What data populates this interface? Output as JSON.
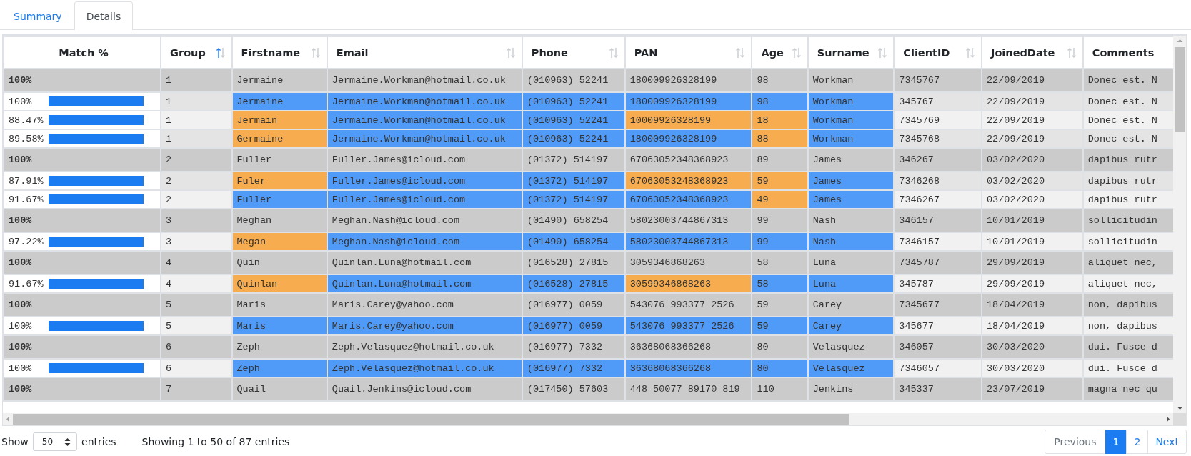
{
  "tabs": [
    {
      "label": "Summary",
      "selected": false
    },
    {
      "label": "Details",
      "selected": true
    }
  ],
  "table": {
    "columns": [
      {
        "label": "Match %"
      },
      {
        "label": "Group",
        "sorted_ascending": true
      },
      {
        "label": "Firstname",
        "sorted_ascending": false
      },
      {
        "label": "Email",
        "sorted_ascending": false
      },
      {
        "label": "Phone",
        "sorted_ascending": false
      },
      {
        "label": "PAN",
        "sorted_ascending": false
      },
      {
        "label": "Age",
        "sorted_ascending": false
      },
      {
        "label": "Surname",
        "sorted_ascending": false
      },
      {
        "label": "ClientID",
        "sorted_ascending": false
      },
      {
        "label": "JoinedDate",
        "sorted_ascending": false
      },
      {
        "label": "Comments"
      }
    ],
    "rows": [
      {
        "kind": "master",
        "cells": [
          {
            "text": "100%"
          },
          {
            "text": "1"
          },
          {
            "text": "Jermaine"
          },
          {
            "text": "Jermaine.Workman@hotmail.co.uk"
          },
          {
            "text": "(010963) 52241"
          },
          {
            "text": "180009926328199"
          },
          {
            "text": "98"
          },
          {
            "text": "Workman"
          },
          {
            "text": "7345767"
          },
          {
            "text": "22/09/2019"
          },
          {
            "text": "Donec est. N"
          }
        ]
      },
      {
        "kind": "match",
        "cells": [
          {
            "text": "100%"
          },
          {
            "text": "1"
          },
          {
            "text": "Jermaine",
            "matches": true
          },
          {
            "text": "Jermaine.Workman@hotmail.co.uk",
            "matches": true
          },
          {
            "text": "(010963) 52241",
            "matches": true
          },
          {
            "text": "180009926328199",
            "matches": true
          },
          {
            "text": "98",
            "matches": true
          },
          {
            "text": "Workman",
            "matches": true
          },
          {
            "text": "345767"
          },
          {
            "text": "22/09/2019"
          },
          {
            "text": "Donec est. N"
          }
        ]
      },
      {
        "kind": "match",
        "cells": [
          {
            "text": "88.47%"
          },
          {
            "text": "1"
          },
          {
            "text": "Jermain",
            "matches": false
          },
          {
            "text": "Jermaine.Workman@hotmail.co.uk",
            "matches": true
          },
          {
            "text": "(010963) 52241",
            "matches": true
          },
          {
            "text": "10009926328199",
            "matches": false
          },
          {
            "text": "18",
            "matches": false
          },
          {
            "text": "Workman",
            "matches": true
          },
          {
            "text": "7345769"
          },
          {
            "text": "22/09/2019"
          },
          {
            "text": "Donec est. N"
          }
        ]
      },
      {
        "kind": "match",
        "cells": [
          {
            "text": "89.58%"
          },
          {
            "text": "1"
          },
          {
            "text": "Germaine",
            "matches": false
          },
          {
            "text": "Jermaine.Workman@hotmail.co.uk",
            "matches": true
          },
          {
            "text": "(010963) 52241",
            "matches": true
          },
          {
            "text": "180009926328199",
            "matches": true
          },
          {
            "text": "88",
            "matches": false
          },
          {
            "text": "Workman",
            "matches": true
          },
          {
            "text": "7345768"
          },
          {
            "text": "22/09/2019"
          },
          {
            "text": "Donec est. N"
          }
        ]
      },
      {
        "kind": "master",
        "cells": [
          {
            "text": "100%"
          },
          {
            "text": "2"
          },
          {
            "text": "Fuller"
          },
          {
            "text": "Fuller.James@icloud.com"
          },
          {
            "text": "(01372) 514197"
          },
          {
            "text": "67063052348368923"
          },
          {
            "text": "89"
          },
          {
            "text": "James"
          },
          {
            "text": "346267"
          },
          {
            "text": "03/02/2020"
          },
          {
            "text": "dapibus rutr"
          }
        ]
      },
      {
        "kind": "match",
        "cells": [
          {
            "text": "87.91%"
          },
          {
            "text": "2"
          },
          {
            "text": "Fuler",
            "matches": false
          },
          {
            "text": "Fuller.James@icloud.com",
            "matches": true
          },
          {
            "text": "(01372) 514197",
            "matches": true
          },
          {
            "text": "67063053248368923",
            "matches": false
          },
          {
            "text": "59",
            "matches": false
          },
          {
            "text": "James",
            "matches": true
          },
          {
            "text": "7346268"
          },
          {
            "text": "03/02/2020"
          },
          {
            "text": "dapibus rutr"
          }
        ]
      },
      {
        "kind": "match",
        "cells": [
          {
            "text": "91.67%"
          },
          {
            "text": "2"
          },
          {
            "text": "Fuller",
            "matches": true
          },
          {
            "text": "Fuller.James@icloud.com",
            "matches": true
          },
          {
            "text": "(01372) 514197",
            "matches": true
          },
          {
            "text": "67063052348368923",
            "matches": true
          },
          {
            "text": "49",
            "matches": false
          },
          {
            "text": "James",
            "matches": true
          },
          {
            "text": "7346267"
          },
          {
            "text": "03/02/2020"
          },
          {
            "text": "dapibus rutr"
          }
        ]
      },
      {
        "kind": "master",
        "cells": [
          {
            "text": "100%"
          },
          {
            "text": "3"
          },
          {
            "text": "Meghan"
          },
          {
            "text": "Meghan.Nash@icloud.com"
          },
          {
            "text": "(01490) 658254"
          },
          {
            "text": "58023003744867313"
          },
          {
            "text": "99"
          },
          {
            "text": "Nash"
          },
          {
            "text": "346157"
          },
          {
            "text": "10/01/2019"
          },
          {
            "text": "sollicitudin"
          }
        ]
      },
      {
        "kind": "match",
        "cells": [
          {
            "text": "97.22%"
          },
          {
            "text": "3"
          },
          {
            "text": "Megan",
            "matches": false
          },
          {
            "text": "Meghan.Nash@icloud.com",
            "matches": true
          },
          {
            "text": "(01490) 658254",
            "matches": true
          },
          {
            "text": "58023003744867313",
            "matches": true
          },
          {
            "text": "99",
            "matches": true
          },
          {
            "text": "Nash",
            "matches": true
          },
          {
            "text": "7346157"
          },
          {
            "text": "10/01/2019"
          },
          {
            "text": "sollicitudin"
          }
        ]
      },
      {
        "kind": "master",
        "cells": [
          {
            "text": "100%"
          },
          {
            "text": "4"
          },
          {
            "text": "Quin"
          },
          {
            "text": "Quinlan.Luna@hotmail.com"
          },
          {
            "text": "(016528) 27815"
          },
          {
            "text": "3059346868263"
          },
          {
            "text": "58"
          },
          {
            "text": "Luna"
          },
          {
            "text": "7345787"
          },
          {
            "text": "29/09/2019"
          },
          {
            "text": "aliquet nec,"
          }
        ]
      },
      {
        "kind": "match",
        "cells": [
          {
            "text": "91.67%"
          },
          {
            "text": "4"
          },
          {
            "text": "Quinlan",
            "matches": false
          },
          {
            "text": "Quinlan.Luna@hotmail.com",
            "matches": true
          },
          {
            "text": "(016528) 27815",
            "matches": true
          },
          {
            "text": "30599346868263",
            "matches": false
          },
          {
            "text": "58",
            "matches": true
          },
          {
            "text": "Luna",
            "matches": true
          },
          {
            "text": "345787"
          },
          {
            "text": "29/09/2019"
          },
          {
            "text": "aliquet nec,"
          }
        ]
      },
      {
        "kind": "master",
        "cells": [
          {
            "text": "100%"
          },
          {
            "text": "5"
          },
          {
            "text": "Maris"
          },
          {
            "text": "Maris.Carey@yahoo.com"
          },
          {
            "text": "(016977) 0059"
          },
          {
            "text": "543076 993377 2526"
          },
          {
            "text": "59"
          },
          {
            "text": "Carey"
          },
          {
            "text": "7345677"
          },
          {
            "text": "18/04/2019"
          },
          {
            "text": "non, dapibus"
          }
        ]
      },
      {
        "kind": "match",
        "cells": [
          {
            "text": "100%"
          },
          {
            "text": "5"
          },
          {
            "text": "Maris",
            "matches": true
          },
          {
            "text": "Maris.Carey@yahoo.com",
            "matches": true
          },
          {
            "text": "(016977) 0059",
            "matches": true
          },
          {
            "text": "543076 993377 2526",
            "matches": true
          },
          {
            "text": "59",
            "matches": true
          },
          {
            "text": "Carey",
            "matches": true
          },
          {
            "text": "345677"
          },
          {
            "text": "18/04/2019"
          },
          {
            "text": "non, dapibus"
          }
        ]
      },
      {
        "kind": "master",
        "cells": [
          {
            "text": "100%"
          },
          {
            "text": "6"
          },
          {
            "text": "Zeph"
          },
          {
            "text": "Zeph.Velasquez@hotmail.co.uk"
          },
          {
            "text": "(016977) 7332"
          },
          {
            "text": "36368068366268"
          },
          {
            "text": "80"
          },
          {
            "text": "Velasquez"
          },
          {
            "text": "346057"
          },
          {
            "text": "30/03/2020"
          },
          {
            "text": "dui. Fusce d"
          }
        ]
      },
      {
        "kind": "match",
        "cells": [
          {
            "text": "100%"
          },
          {
            "text": "6"
          },
          {
            "text": "Zeph",
            "matches": true
          },
          {
            "text": "Zeph.Velasquez@hotmail.co.uk",
            "matches": true
          },
          {
            "text": "(016977) 7332",
            "matches": true
          },
          {
            "text": "36368068366268",
            "matches": true
          },
          {
            "text": "80",
            "matches": true
          },
          {
            "text": "Velasquez",
            "matches": true
          },
          {
            "text": "7346057"
          },
          {
            "text": "30/03/2020"
          },
          {
            "text": "dui. Fusce d"
          }
        ]
      },
      {
        "kind": "master",
        "cells": [
          {
            "text": "100%"
          },
          {
            "text": "7"
          },
          {
            "text": "Quail"
          },
          {
            "text": "Quail.Jenkins@icloud.com"
          },
          {
            "text": "(017450) 57603"
          },
          {
            "text": "448 50077 89170 819"
          },
          {
            "text": "110"
          },
          {
            "text": "Jenkins"
          },
          {
            "text": "345337"
          },
          {
            "text": "23/07/2019"
          },
          {
            "text": "magna nec qu"
          }
        ]
      }
    ]
  },
  "footer": {
    "show_label": "Show",
    "page_size": "50",
    "entries_label": "entries",
    "info": "Showing 1 to 50 of 87 entries",
    "pagination": [
      {
        "label": "Previous",
        "selected": false
      },
      {
        "label": "1",
        "selected": true
      },
      {
        "label": "2",
        "selected": false
      },
      {
        "label": "Next",
        "selected": false
      }
    ]
  }
}
